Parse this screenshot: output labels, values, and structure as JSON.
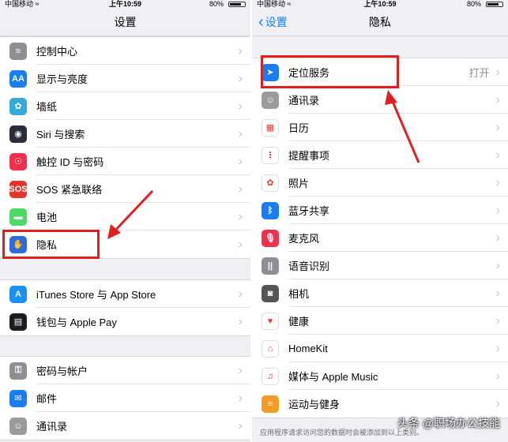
{
  "left": {
    "status": {
      "carrier": "中国移动 ≈",
      "time": "上午10:59",
      "battery": "80%"
    },
    "title": "设置",
    "group1": [
      {
        "label": "控制中心",
        "icon": "toggles-icon",
        "color": "#8e8e93",
        "glyph": "≡"
      },
      {
        "label": "显示与亮度",
        "icon": "text-size-icon",
        "color": "#1a7ef0",
        "glyph": "AA"
      },
      {
        "label": "墙纸",
        "icon": "flower-icon",
        "color": "#36aadc",
        "glyph": "✿"
      },
      {
        "label": "Siri 与搜索",
        "icon": "siri-icon",
        "color": "#2b2b3a",
        "glyph": "◉"
      },
      {
        "label": "触控 ID 与密码",
        "icon": "fingerprint-icon",
        "color": "#f0304d",
        "glyph": "☉"
      },
      {
        "label": "SOS 紧急联络",
        "icon": "sos-icon",
        "color": "#e3352d",
        "glyph": "SOS"
      },
      {
        "label": "电池",
        "icon": "battery-icon",
        "color": "#4cd964",
        "glyph": "▬"
      },
      {
        "label": "隐私",
        "icon": "hand-icon",
        "color": "#2f6be0",
        "glyph": "✋"
      }
    ],
    "group2": [
      {
        "label": "iTunes Store 与 App Store",
        "icon": "app-store-icon",
        "color": "#1a8ff5",
        "glyph": "A"
      },
      {
        "label": "钱包与 Apple Pay",
        "icon": "wallet-icon",
        "color": "#1c1c1e",
        "glyph": "▤"
      }
    ],
    "group3": [
      {
        "label": "密码与帐户",
        "icon": "key-icon",
        "color": "#8e8e93",
        "glyph": "⚿"
      },
      {
        "label": "邮件",
        "icon": "mail-icon",
        "color": "#1a7ef0",
        "glyph": "✉"
      },
      {
        "label": "通讯录",
        "icon": "contacts-icon",
        "color": "#9b9b9b",
        "glyph": "☺"
      }
    ]
  },
  "right": {
    "status": {
      "carrier": "中国移动 ≈",
      "time": "上午10:59",
      "battery": "80%"
    },
    "back_label": "设置",
    "title": "隐私",
    "items": [
      {
        "label": "定位服务",
        "value": "打开",
        "icon": "location-arrow-icon",
        "color": "#1a7ef0",
        "glyph": "➤"
      },
      {
        "label": "通讯录",
        "value": "",
        "icon": "contacts-icon",
        "color": "#9b9b9b",
        "glyph": "☺"
      },
      {
        "label": "日历",
        "value": "",
        "icon": "calendar-icon",
        "color": "#ffffff",
        "glyph": "▦"
      },
      {
        "label": "提醒事项",
        "value": "",
        "icon": "reminders-icon",
        "color": "#ffffff",
        "glyph": "⋮"
      },
      {
        "label": "照片",
        "value": "",
        "icon": "photos-icon",
        "color": "#ffffff",
        "glyph": "✿"
      },
      {
        "label": "蓝牙共享",
        "value": "",
        "icon": "bluetooth-icon",
        "color": "#1a7ef0",
        "glyph": "ᛒ"
      },
      {
        "label": "麦克风",
        "value": "",
        "icon": "microphone-icon",
        "color": "#f0304d",
        "glyph": "🎙"
      },
      {
        "label": "语音识别",
        "value": "",
        "icon": "waveform-icon",
        "color": "#8e8e93",
        "glyph": "||"
      },
      {
        "label": "相机",
        "value": "",
        "icon": "camera-icon",
        "color": "#555555",
        "glyph": "◙"
      },
      {
        "label": "健康",
        "value": "",
        "icon": "heart-icon",
        "color": "#ffffff",
        "glyph": "♥"
      },
      {
        "label": "HomeKit",
        "value": "",
        "icon": "home-icon",
        "color": "#ffffff",
        "glyph": "⌂"
      },
      {
        "label": "媒体与 Apple Music",
        "value": "",
        "icon": "music-note-icon",
        "color": "#ffffff",
        "glyph": "♫"
      },
      {
        "label": "运动与健身",
        "value": "",
        "icon": "motion-icon",
        "color": "#f59a23",
        "glyph": "≡"
      }
    ],
    "footer": "应用程序请求访问您的数据时会被添加到以上类别。"
  },
  "watermark": "头条 @职场办公技能"
}
